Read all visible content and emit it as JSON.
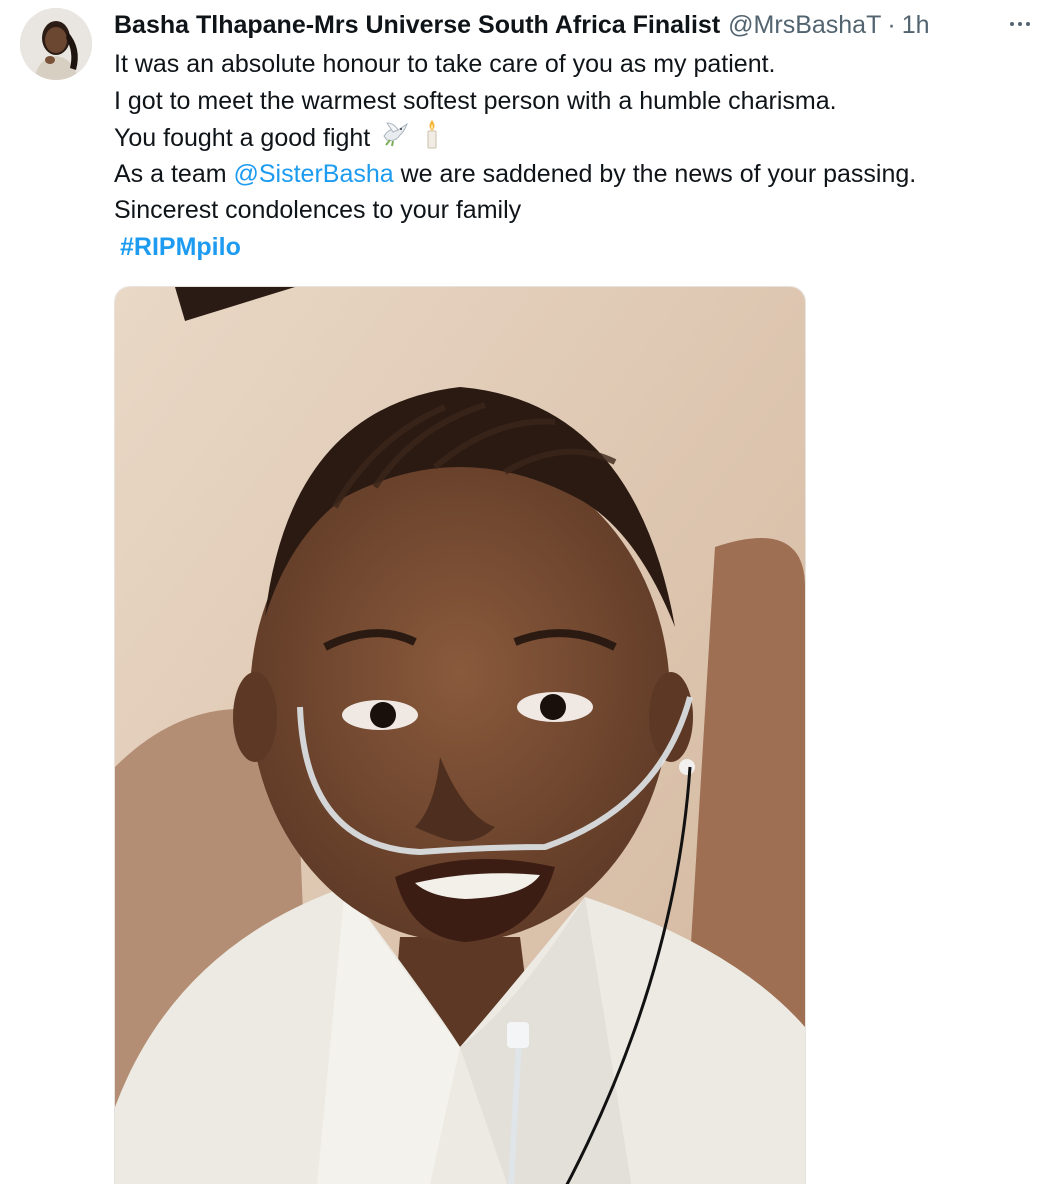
{
  "tweet": {
    "author": {
      "display_name": "Basha Tlhapane-Mrs Universe South Africa Finalist",
      "handle": "@MrsBashaT",
      "separator": "·",
      "time": "1h",
      "avatar_icon": "profile-photo-avatar"
    },
    "more_icon": "ellipsis-icon",
    "lines": [
      "It was an absolute honour to take care of you as my patient.",
      "I got to meet the warmest softest person with a humble charisma.",
      "You fought a good fight"
    ],
    "line3_emojis": [
      "dove-icon",
      "candle-icon"
    ],
    "line4": {
      "prefix": "As a team ",
      "mention": "@SisterBasha",
      "suffix": " we are saddened by the news of your passing."
    },
    "line5": "Sincerest condolences to your family",
    "hashtag": "#RIPMpilo",
    "media": {
      "type": "photo",
      "icon": "smiling-woman-photo"
    },
    "colors": {
      "link": "#1d9bf0",
      "secondary_text": "#536471",
      "primary_text": "#0f1419"
    }
  }
}
